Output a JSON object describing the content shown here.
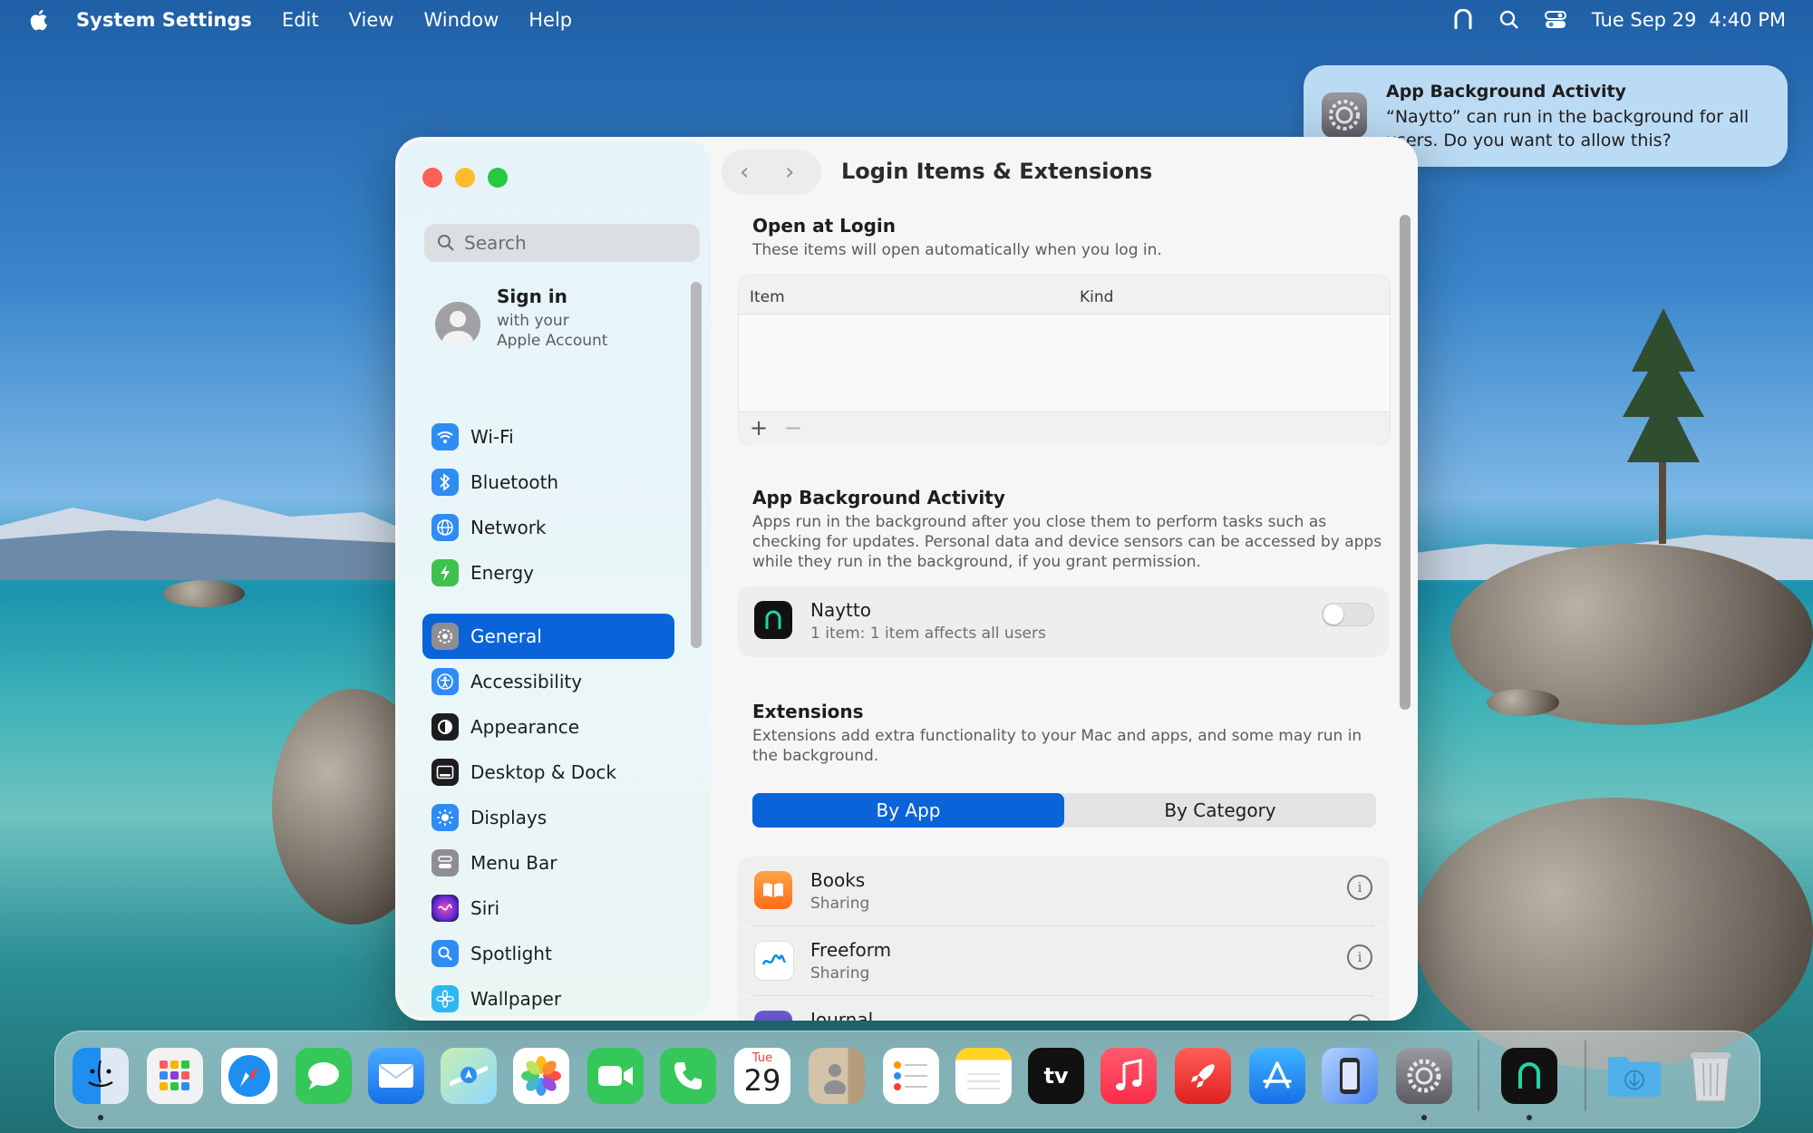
{
  "menubar": {
    "app_name": "System Settings",
    "menus": [
      "Edit",
      "View",
      "Window",
      "Help"
    ],
    "date": "Tue Sep 29",
    "time": "4:40 PM"
  },
  "notification": {
    "title": "App Background Activity",
    "body": "“Naytto” can run in the background for all users. Do you want to allow this?"
  },
  "sidebar": {
    "search_placeholder": "Search",
    "account": {
      "title": "Sign in",
      "line1": "with your",
      "line2": "Apple Account"
    },
    "items": [
      {
        "label": "Wi-Fi",
        "icon": "wifi-icon",
        "color": "#2f8cf5"
      },
      {
        "label": "Bluetooth",
        "icon": "bluetooth-icon",
        "color": "#2f8cf5"
      },
      {
        "label": "Network",
        "icon": "globe-icon",
        "color": "#2f8cf5"
      },
      {
        "label": "Energy",
        "icon": "bolt-icon",
        "color": "#3fc14d"
      },
      {
        "label": "General",
        "icon": "gear-icon",
        "color": "#8e8e93",
        "selected": true
      },
      {
        "label": "Accessibility",
        "icon": "accessibility-icon",
        "color": "#2f8cf5"
      },
      {
        "label": "Appearance",
        "icon": "appearance-icon",
        "color": "#1d1d1f"
      },
      {
        "label": "Desktop & Dock",
        "icon": "dock-icon",
        "color": "#1d1d1f"
      },
      {
        "label": "Displays",
        "icon": "sun-icon",
        "color": "#2f8cf5"
      },
      {
        "label": "Menu Bar",
        "icon": "menubar-icon",
        "color": "#8e8e93"
      },
      {
        "label": "Siri",
        "icon": "siri-icon",
        "color": "#8a3bd9"
      },
      {
        "label": "Spotlight",
        "icon": "magnifier-icon",
        "color": "#2f8cf5"
      },
      {
        "label": "Wallpaper",
        "icon": "flower-icon",
        "color": "#2fb7f0"
      }
    ]
  },
  "main": {
    "title": "Login Items & Extensions",
    "open_at_login": {
      "heading": "Open at Login",
      "desc": "These items will open automatically when you log in.",
      "col_item": "Item",
      "col_kind": "Kind",
      "add": "+",
      "remove": "−"
    },
    "background": {
      "heading": "App Background Activity",
      "desc": "Apps run in the background after you close them to perform tasks such as checking for updates. Personal data and device sensors can be accessed by apps while they run in the background, if you grant permission.",
      "app_name": "Naytto",
      "app_sub": "1 item: 1 item affects all users",
      "enabled": false
    },
    "extensions": {
      "heading": "Extensions",
      "desc": "Extensions add extra functionality to your Mac and apps, and some may run in the background.",
      "seg_by_app": "By App",
      "seg_by_category": "By Category",
      "selected_segment": "By App",
      "rows": [
        {
          "name": "Books",
          "sub": "Sharing",
          "icon": "books-icon"
        },
        {
          "name": "Freeform",
          "sub": "Sharing",
          "icon": "freeform-icon"
        },
        {
          "name": "Journal",
          "sub": "",
          "icon": "journal-icon"
        }
      ],
      "info_glyph": "i"
    }
  },
  "dock": {
    "calendar_month": "Tue",
    "calendar_day": "29",
    "tv_label": "tv",
    "apps": [
      "finder-icon",
      "launchpad-icon",
      "safari-icon",
      "messages-icon",
      "mail-icon",
      "maps-icon",
      "photos-icon",
      "facetime-icon",
      "phone-icon",
      "calendar-icon",
      "contacts-icon",
      "reminders-icon",
      "notes-icon",
      "tv-icon",
      "music-icon",
      "rocket-icon",
      "app-store-icon",
      "iphone-mirroring-icon",
      "system-settings-icon",
      "naytto-icon",
      "downloads-folder-icon",
      "trash-icon"
    ]
  }
}
